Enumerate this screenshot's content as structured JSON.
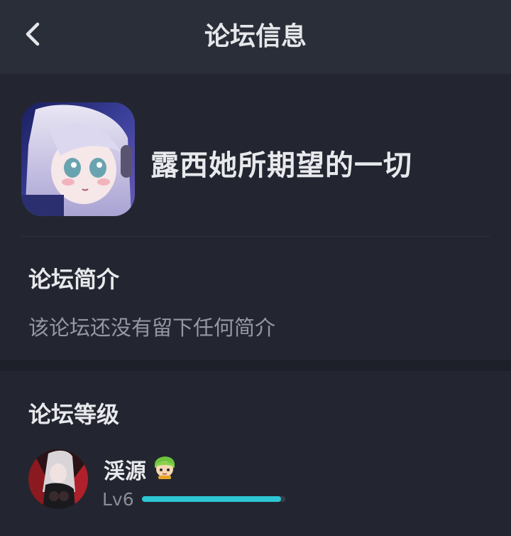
{
  "header": {
    "title": "论坛信息",
    "back_icon": "chevron-left-icon"
  },
  "forum": {
    "name": "露西她所期望的一切"
  },
  "intro": {
    "title": "论坛简介",
    "text": "该论坛还没有留下任何简介"
  },
  "level": {
    "title": "论坛等级",
    "user": {
      "name": "渓源",
      "badge_icon": "green-hair-character-badge-icon",
      "level_label": "Lv6",
      "progress": 0.97
    }
  },
  "colors": {
    "accent": "#2ec6d4",
    "background": "#1e2029",
    "card": "#232630",
    "header": "#2a2e38"
  }
}
